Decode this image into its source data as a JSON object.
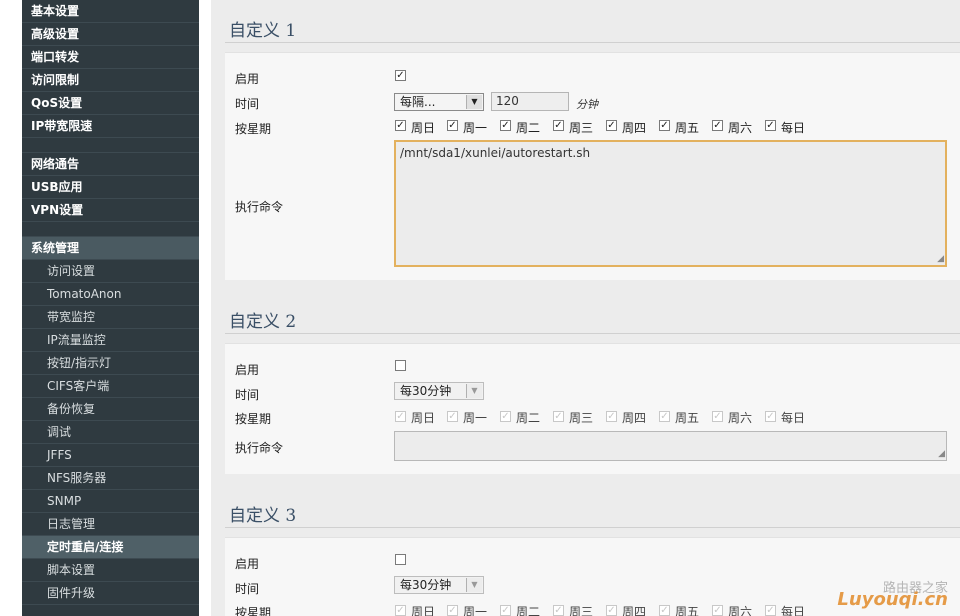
{
  "sidebar": {
    "group1": [
      "基本设置",
      "高级设置",
      "端口转发",
      "访问限制",
      "QoS设置",
      "IP带宽限速"
    ],
    "group2": [
      "网络通告",
      "USB应用",
      "VPN设置"
    ],
    "section_title": "系统管理",
    "sub_items": [
      "访问设置",
      "TomatoAnon",
      "带宽监控",
      "IP流量监控",
      "按钮/指示灯",
      "CIFS客户端",
      "备份恢复",
      "调试",
      "JFFS",
      "NFS服务器",
      "SNMP",
      "日志管理",
      "定时重启/连接",
      "脚本设置",
      "固件升级"
    ],
    "active_sub": "定时重启/连接"
  },
  "labels": {
    "enable": "启用",
    "time": "时间",
    "weekdays": "按星期",
    "command": "执行命令",
    "days": [
      "周日",
      "周一",
      "周二",
      "周三",
      "周四",
      "周五",
      "周六",
      "每日"
    ]
  },
  "custom1": {
    "title": "自定义 1",
    "enabled": true,
    "time_select": "每隔...",
    "interval_value": "120",
    "interval_unit": "分钟",
    "command": "/mnt/sda1/xunlei/autorestart.sh"
  },
  "custom2": {
    "title": "自定义 2",
    "enabled": false,
    "time_select": "每30分钟",
    "command": ""
  },
  "custom3": {
    "title": "自定义 3",
    "enabled": false,
    "time_select": "每30分钟"
  },
  "watermark": {
    "text": "Luyouqi.cn",
    "cn": "路由器之家"
  },
  "colors": {
    "sidebar_bg": "#2f3a40",
    "focus_border": "#e3b15e",
    "title_color": "#3a4f66"
  }
}
